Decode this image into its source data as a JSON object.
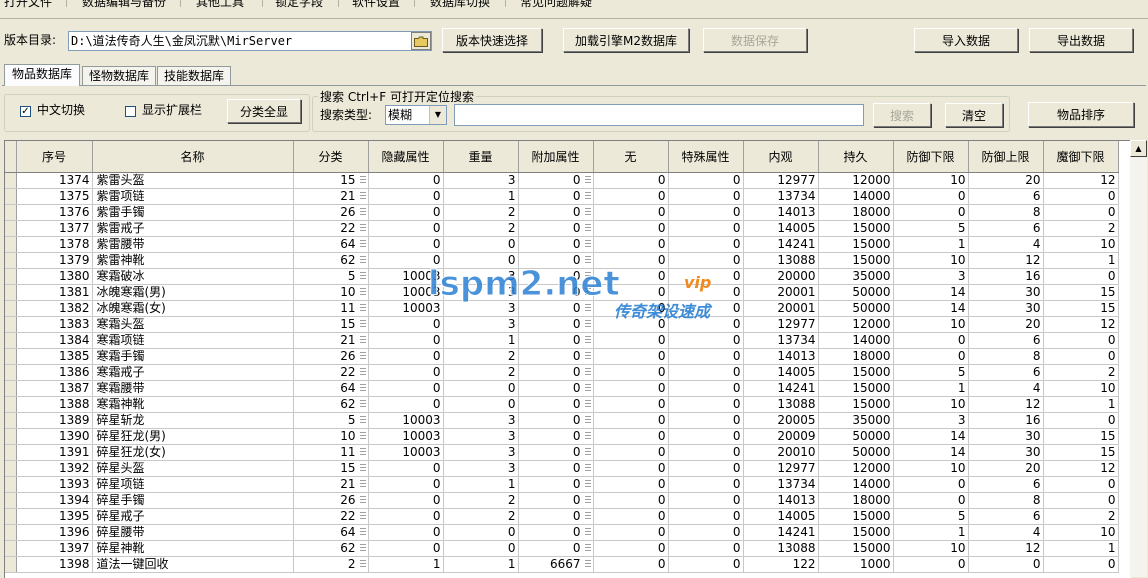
{
  "menu": [
    "打开文件",
    "数据编辑与备份",
    "其他工具",
    "锁定字段",
    "软件设置",
    "数据库切换",
    "常见问题解疑"
  ],
  "toolbar": {
    "dir_label": "版本目录:",
    "dir_value": "D:\\道法传奇人生\\金凤沉默\\MirServer",
    "quick_select": "版本快速选择",
    "load_engine": "加载引擎M2数据库",
    "save_data": "数据保存",
    "import_data": "导入数据",
    "export_data": "导出数据"
  },
  "tabs": [
    "物品数据库",
    "怪物数据库",
    "技能数据库"
  ],
  "options": {
    "chinese_toggle": "中文切换",
    "chinese_checked": true,
    "show_ext": "显示扩展栏",
    "show_ext_checked": false,
    "show_all": "分类全显"
  },
  "search": {
    "group_title": "搜索  Ctrl+F 可打开定位搜索",
    "type_label": "搜索类型:",
    "type_value": "模糊",
    "query": "",
    "search_button": "搜索",
    "clear_button": "清空"
  },
  "sort_button": "物品排序",
  "watermark": {
    "main": "lspm2.net",
    "sub": "传奇架设速成",
    "tag": "vip"
  },
  "table": {
    "columns": [
      "序号",
      "名称",
      "分类",
      "隐藏属性",
      "重量",
      "附加属性",
      "无",
      "特殊属性",
      "内观",
      "持久",
      "防御下限",
      "防御上限",
      "魔御下限"
    ],
    "rows": [
      [
        "1374",
        "紫雷头盔",
        "15",
        "0",
        "3",
        "0",
        "0",
        "0",
        "12977",
        "12000",
        "10",
        "20",
        "12"
      ],
      [
        "1375",
        "紫雷项链",
        "21",
        "0",
        "1",
        "0",
        "0",
        "0",
        "13734",
        "14000",
        "0",
        "6",
        "0"
      ],
      [
        "1376",
        "紫雷手镯",
        "26",
        "0",
        "2",
        "0",
        "0",
        "0",
        "14013",
        "18000",
        "0",
        "8",
        "0"
      ],
      [
        "1377",
        "紫雷戒子",
        "22",
        "0",
        "2",
        "0",
        "0",
        "0",
        "14005",
        "15000",
        "5",
        "6",
        "2"
      ],
      [
        "1378",
        "紫雷腰带",
        "64",
        "0",
        "0",
        "0",
        "0",
        "0",
        "14241",
        "15000",
        "1",
        "4",
        "10"
      ],
      [
        "1379",
        "紫雷神靴",
        "62",
        "0",
        "0",
        "0",
        "0",
        "0",
        "13088",
        "15000",
        "10",
        "12",
        "1"
      ],
      [
        "1380",
        "寒霜破冰",
        "5",
        "10003",
        "3",
        "0",
        "0",
        "0",
        "20000",
        "35000",
        "3",
        "16",
        "0"
      ],
      [
        "1381",
        "冰魄寒霜(男)",
        "10",
        "10003",
        "3",
        "0",
        "0",
        "0",
        "20001",
        "50000",
        "14",
        "30",
        "15"
      ],
      [
        "1382",
        "冰魄寒霜(女)",
        "11",
        "10003",
        "3",
        "0",
        "0",
        "0",
        "20001",
        "50000",
        "14",
        "30",
        "15"
      ],
      [
        "1383",
        "寒霜头盔",
        "15",
        "0",
        "3",
        "0",
        "0",
        "0",
        "12977",
        "12000",
        "10",
        "20",
        "12"
      ],
      [
        "1384",
        "寒霜项链",
        "21",
        "0",
        "1",
        "0",
        "0",
        "0",
        "13734",
        "14000",
        "0",
        "6",
        "0"
      ],
      [
        "1385",
        "寒霜手镯",
        "26",
        "0",
        "2",
        "0",
        "0",
        "0",
        "14013",
        "18000",
        "0",
        "8",
        "0"
      ],
      [
        "1386",
        "寒霜戒子",
        "22",
        "0",
        "2",
        "0",
        "0",
        "0",
        "14005",
        "15000",
        "5",
        "6",
        "2"
      ],
      [
        "1387",
        "寒霜腰带",
        "64",
        "0",
        "0",
        "0",
        "0",
        "0",
        "14241",
        "15000",
        "1",
        "4",
        "10"
      ],
      [
        "1388",
        "寒霜神靴",
        "62",
        "0",
        "0",
        "0",
        "0",
        "0",
        "13088",
        "15000",
        "10",
        "12",
        "1"
      ],
      [
        "1389",
        "碎星斩龙",
        "5",
        "10003",
        "3",
        "0",
        "0",
        "0",
        "20005",
        "35000",
        "3",
        "16",
        "0"
      ],
      [
        "1390",
        "碎星狂龙(男)",
        "10",
        "10003",
        "3",
        "0",
        "0",
        "0",
        "20009",
        "50000",
        "14",
        "30",
        "15"
      ],
      [
        "1391",
        "碎星狂龙(女)",
        "11",
        "10003",
        "3",
        "0",
        "0",
        "0",
        "20010",
        "50000",
        "14",
        "30",
        "15"
      ],
      [
        "1392",
        "碎星头盔",
        "15",
        "0",
        "3",
        "0",
        "0",
        "0",
        "12977",
        "12000",
        "10",
        "20",
        "12"
      ],
      [
        "1393",
        "碎星项链",
        "21",
        "0",
        "1",
        "0",
        "0",
        "0",
        "13734",
        "14000",
        "0",
        "6",
        "0"
      ],
      [
        "1394",
        "碎星手镯",
        "26",
        "0",
        "2",
        "0",
        "0",
        "0",
        "14013",
        "18000",
        "0",
        "8",
        "0"
      ],
      [
        "1395",
        "碎星戒子",
        "22",
        "0",
        "2",
        "0",
        "0",
        "0",
        "14005",
        "15000",
        "5",
        "6",
        "2"
      ],
      [
        "1396",
        "碎星腰带",
        "64",
        "0",
        "0",
        "0",
        "0",
        "0",
        "14241",
        "15000",
        "1",
        "4",
        "10"
      ],
      [
        "1397",
        "碎星神靴",
        "62",
        "0",
        "0",
        "0",
        "0",
        "0",
        "13088",
        "15000",
        "10",
        "12",
        "1"
      ],
      [
        "1398",
        "道法一键回收",
        "2",
        "1",
        "1",
        "6667",
        "0",
        "0",
        "122",
        "1000",
        "0",
        "0",
        "0"
      ]
    ]
  }
}
